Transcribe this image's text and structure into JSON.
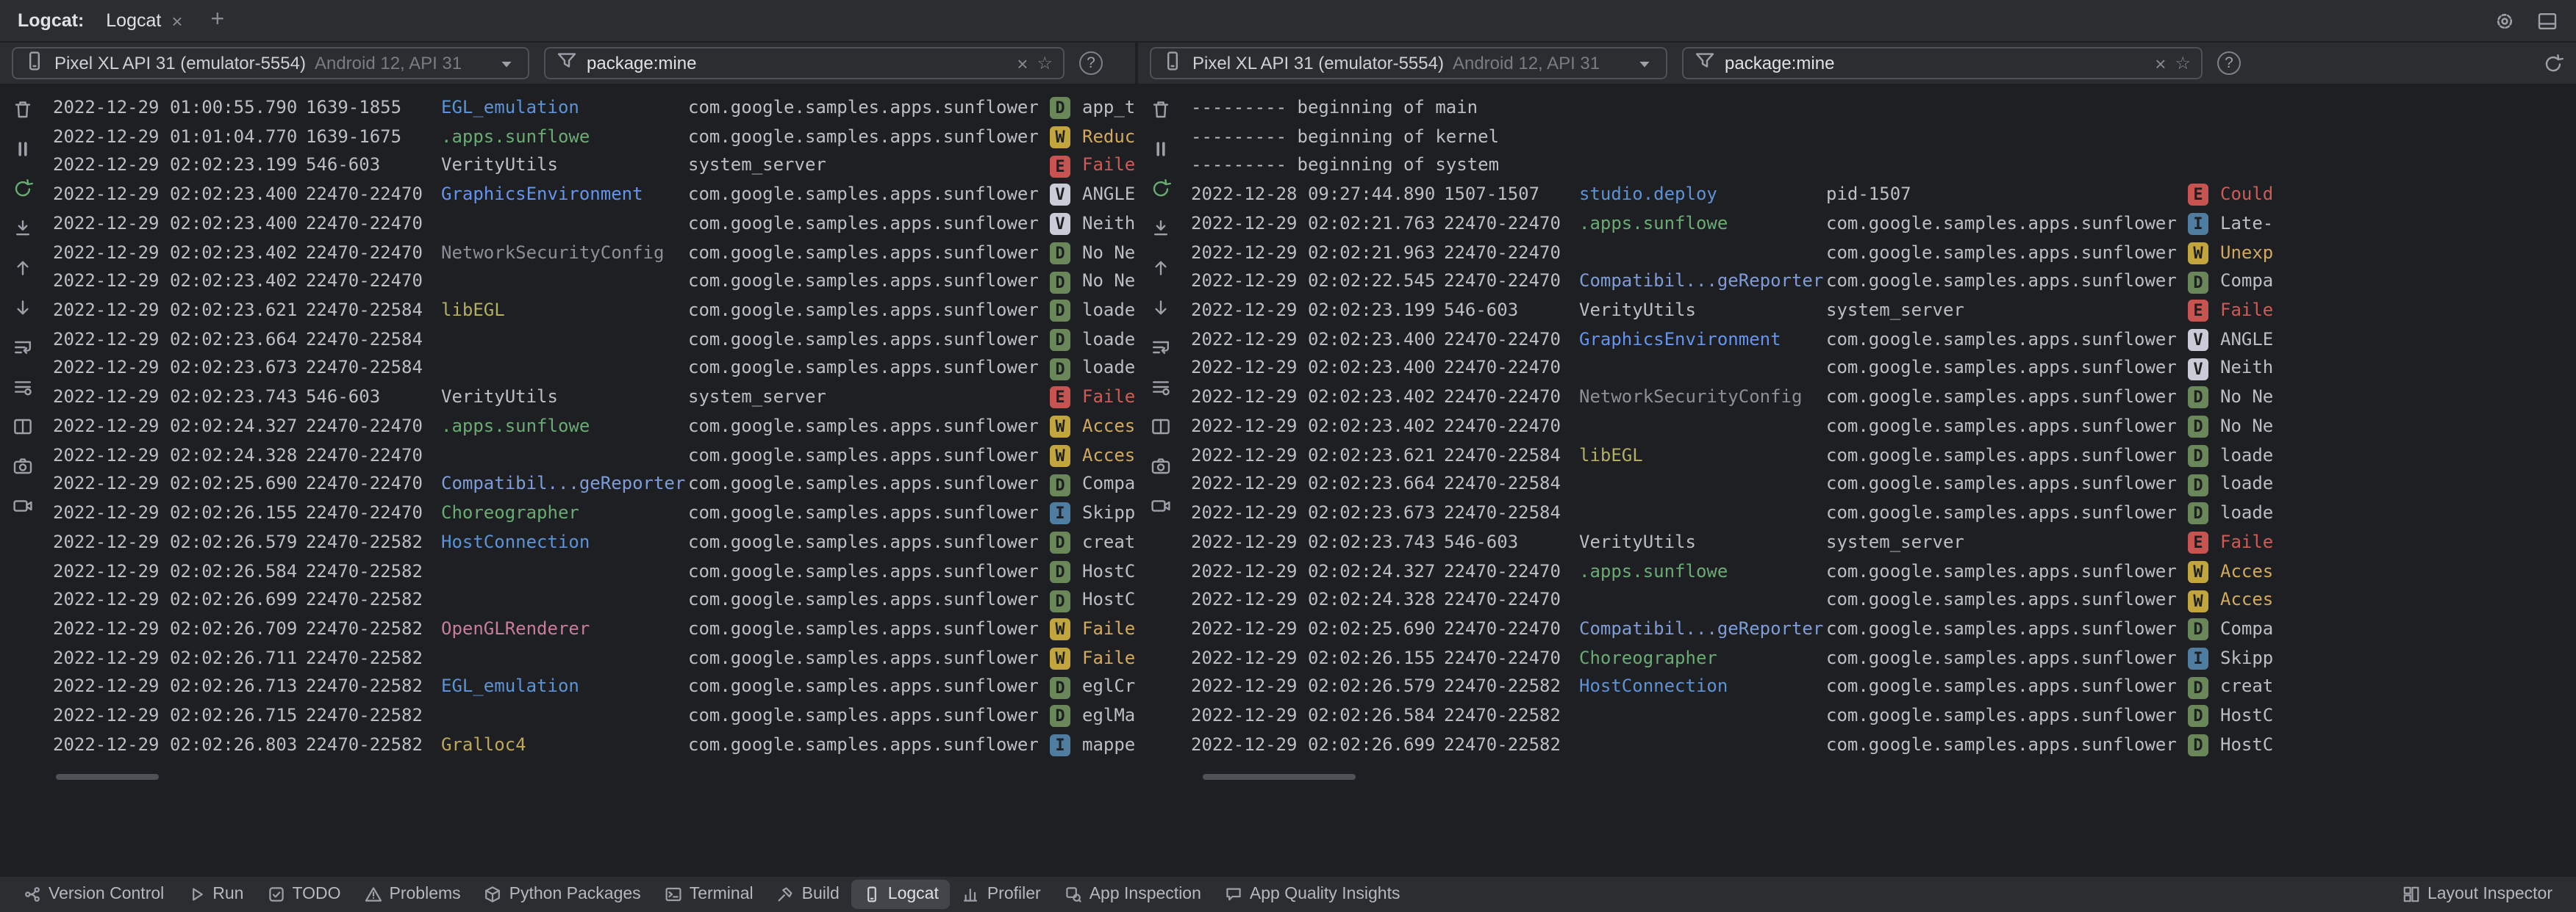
{
  "tab_bar": {
    "title": "Logcat:",
    "tabs": [
      {
        "label": "Logcat",
        "close": "×",
        "selected": true
      }
    ],
    "add_tab": "+"
  },
  "toolbar": {
    "clear_glyph": "×",
    "favorite_glyph": "☆",
    "help_glyph": "?"
  },
  "rail_icons": [
    "clear-logcat-icon",
    "pause-logcat-icon",
    "restart-logcat-icon",
    "scroll-to-end-icon",
    "previous-occurrence-icon",
    "next-occurrence-icon",
    "soft-wrap-icon",
    "configure-logcat-icon",
    "split-panels-icon",
    "screenshot-icon",
    "screen-record-icon"
  ],
  "log_colors": {
    "levels": {
      "V": {
        "bg": "#c9ccd6",
        "fg": "#1e1f22"
      },
      "D": {
        "bg": "#6a8759",
        "fg": "#1e1f22"
      },
      "I": {
        "bg": "#4f7da0",
        "fg": "#1e1f22"
      },
      "W": {
        "bg": "#c2a53c",
        "fg": "#1e1f22"
      },
      "E": {
        "bg": "#c75450",
        "fg": "#1e1f22"
      }
    },
    "messages": {
      "V": "#bcbec4",
      "D": "#bcbec4",
      "I": "#bcbec4",
      "W": "#d2a95d",
      "E": "#cf5b56"
    },
    "tags": {
      "default": "#bcbec4",
      "blue": "#5c93d6",
      "blue2": "#6494ed",
      "blue3": "#7e9cd8",
      "green": "#6aab73",
      "gray": "#8a8f98",
      "olive": "#b3ae60",
      "pink": "#c77d9b",
      "yellow": "#bfa65a"
    }
  },
  "panes": [
    {
      "device_label": "Pixel XL API 31 (emulator-5554)",
      "device_spec": "Android 12, API 31",
      "filter_value": "package:mine",
      "rows": [
        {
          "time": "2022-12-29 01:00:55.790",
          "pids": "1639-1855",
          "tag": "EGL_emulation",
          "tag_color": "blue",
          "package": "com.google.samples.apps.sunflower",
          "level": "D",
          "message": "app_t"
        },
        {
          "time": "2022-12-29 01:01:04.770",
          "pids": "1639-1675",
          "tag": ".apps.sunflowe",
          "tag_color": "green",
          "package": "com.google.samples.apps.sunflower",
          "level": "W",
          "message": "Reduc"
        },
        {
          "time": "2022-12-29 02:02:23.199",
          "pids": "546-603",
          "tag": "VerityUtils",
          "tag_color": "default",
          "package": "system_server",
          "level": "E",
          "message": "Faile"
        },
        {
          "time": "2022-12-29 02:02:23.400",
          "pids": "22470-22470",
          "tag": "GraphicsEnvironment",
          "tag_color": "blue2",
          "package": "com.google.samples.apps.sunflower",
          "level": "V",
          "message": "ANGLE"
        },
        {
          "time": "2022-12-29 02:02:23.400",
          "pids": "22470-22470",
          "tag": "",
          "tag_color": "default",
          "package": "com.google.samples.apps.sunflower",
          "level": "V",
          "message": "Neith"
        },
        {
          "time": "2022-12-29 02:02:23.402",
          "pids": "22470-22470",
          "tag": "NetworkSecurityConfig",
          "tag_color": "gray",
          "package": "com.google.samples.apps.sunflower",
          "level": "D",
          "message": "No Ne"
        },
        {
          "time": "2022-12-29 02:02:23.402",
          "pids": "22470-22470",
          "tag": "",
          "tag_color": "default",
          "package": "com.google.samples.apps.sunflower",
          "level": "D",
          "message": "No Ne"
        },
        {
          "time": "2022-12-29 02:02:23.621",
          "pids": "22470-22584",
          "tag": "libEGL",
          "tag_color": "olive",
          "package": "com.google.samples.apps.sunflower",
          "level": "D",
          "message": "loade"
        },
        {
          "time": "2022-12-29 02:02:23.664",
          "pids": "22470-22584",
          "tag": "",
          "tag_color": "default",
          "package": "com.google.samples.apps.sunflower",
          "level": "D",
          "message": "loade"
        },
        {
          "time": "2022-12-29 02:02:23.673",
          "pids": "22470-22584",
          "tag": "",
          "tag_color": "default",
          "package": "com.google.samples.apps.sunflower",
          "level": "D",
          "message": "loade"
        },
        {
          "time": "2022-12-29 02:02:23.743",
          "pids": "546-603",
          "tag": "VerityUtils",
          "tag_color": "default",
          "package": "system_server",
          "level": "E",
          "message": "Faile"
        },
        {
          "time": "2022-12-29 02:02:24.327",
          "pids": "22470-22470",
          "tag": ".apps.sunflowe",
          "tag_color": "green",
          "package": "com.google.samples.apps.sunflower",
          "level": "W",
          "message": "Acces"
        },
        {
          "time": "2022-12-29 02:02:24.328",
          "pids": "22470-22470",
          "tag": "",
          "tag_color": "default",
          "package": "com.google.samples.apps.sunflower",
          "level": "W",
          "message": "Acces"
        },
        {
          "time": "2022-12-29 02:02:25.690",
          "pids": "22470-22470",
          "tag": "Compatibil...geReporter",
          "tag_color": "blue3",
          "package": "com.google.samples.apps.sunflower",
          "level": "D",
          "message": "Compa"
        },
        {
          "time": "2022-12-29 02:02:26.155",
          "pids": "22470-22470",
          "tag": "Choreographer",
          "tag_color": "green",
          "package": "com.google.samples.apps.sunflower",
          "level": "I",
          "message": "Skipp"
        },
        {
          "time": "2022-12-29 02:02:26.579",
          "pids": "22470-22582",
          "tag": "HostConnection",
          "tag_color": "blue",
          "package": "com.google.samples.apps.sunflower",
          "level": "D",
          "message": "creat"
        },
        {
          "time": "2022-12-29 02:02:26.584",
          "pids": "22470-22582",
          "tag": "",
          "tag_color": "default",
          "package": "com.google.samples.apps.sunflower",
          "level": "D",
          "message": "HostC"
        },
        {
          "time": "2022-12-29 02:02:26.699",
          "pids": "22470-22582",
          "tag": "",
          "tag_color": "default",
          "package": "com.google.samples.apps.sunflower",
          "level": "D",
          "message": "HostC"
        },
        {
          "time": "2022-12-29 02:02:26.709",
          "pids": "22470-22582",
          "tag": "OpenGLRenderer",
          "tag_color": "pink",
          "package": "com.google.samples.apps.sunflower",
          "level": "W",
          "message": "Faile"
        },
        {
          "time": "2022-12-29 02:02:26.711",
          "pids": "22470-22582",
          "tag": "",
          "tag_color": "default",
          "package": "com.google.samples.apps.sunflower",
          "level": "W",
          "message": "Faile"
        },
        {
          "time": "2022-12-29 02:02:26.713",
          "pids": "22470-22582",
          "tag": "EGL_emulation",
          "tag_color": "blue",
          "package": "com.google.samples.apps.sunflower",
          "level": "D",
          "message": "eglCr"
        },
        {
          "time": "2022-12-29 02:02:26.715",
          "pids": "22470-22582",
          "tag": "",
          "tag_color": "default",
          "package": "com.google.samples.apps.sunflower",
          "level": "D",
          "message": "eglMa"
        },
        {
          "time": "2022-12-29 02:02:26.803",
          "pids": "22470-22582",
          "tag": "Gralloc4",
          "tag_color": "yellow",
          "package": "com.google.samples.apps.sunflower",
          "level": "I",
          "message": "mappe"
        }
      ]
    },
    {
      "device_label": "Pixel XL API 31 (emulator-5554)",
      "device_spec": "Android 12, API 31",
      "filter_value": "package:mine",
      "rows": [
        {
          "banner": "--------- beginning of main"
        },
        {
          "banner": "--------- beginning of kernel"
        },
        {
          "banner": "--------- beginning of system"
        },
        {
          "time": "2022-12-28 09:27:44.890",
          "pids": "1507-1507",
          "tag": "studio.deploy",
          "tag_color": "blue",
          "package": "pid-1507",
          "level": "E",
          "message": "Could"
        },
        {
          "time": "2022-12-29 02:02:21.763",
          "pids": "22470-22470",
          "tag": ".apps.sunflowe",
          "tag_color": "green",
          "package": "com.google.samples.apps.sunflower",
          "level": "I",
          "message": "Late-"
        },
        {
          "time": "2022-12-29 02:02:21.963",
          "pids": "22470-22470",
          "tag": "",
          "tag_color": "default",
          "package": "com.google.samples.apps.sunflower",
          "level": "W",
          "message": "Unexp"
        },
        {
          "time": "2022-12-29 02:02:22.545",
          "pids": "22470-22470",
          "tag": "Compatibil...geReporter",
          "tag_color": "blue3",
          "package": "com.google.samples.apps.sunflower",
          "level": "D",
          "message": "Compa"
        },
        {
          "time": "2022-12-29 02:02:23.199",
          "pids": "546-603",
          "tag": "VerityUtils",
          "tag_color": "default",
          "package": "system_server",
          "level": "E",
          "message": "Faile"
        },
        {
          "time": "2022-12-29 02:02:23.400",
          "pids": "22470-22470",
          "tag": "GraphicsEnvironment",
          "tag_color": "blue2",
          "package": "com.google.samples.apps.sunflower",
          "level": "V",
          "message": "ANGLE"
        },
        {
          "time": "2022-12-29 02:02:23.400",
          "pids": "22470-22470",
          "tag": "",
          "tag_color": "default",
          "package": "com.google.samples.apps.sunflower",
          "level": "V",
          "message": "Neith"
        },
        {
          "time": "2022-12-29 02:02:23.402",
          "pids": "22470-22470",
          "tag": "NetworkSecurityConfig",
          "tag_color": "gray",
          "package": "com.google.samples.apps.sunflower",
          "level": "D",
          "message": "No Ne"
        },
        {
          "time": "2022-12-29 02:02:23.402",
          "pids": "22470-22470",
          "tag": "",
          "tag_color": "default",
          "package": "com.google.samples.apps.sunflower",
          "level": "D",
          "message": "No Ne"
        },
        {
          "time": "2022-12-29 02:02:23.621",
          "pids": "22470-22584",
          "tag": "libEGL",
          "tag_color": "olive",
          "package": "com.google.samples.apps.sunflower",
          "level": "D",
          "message": "loade"
        },
        {
          "time": "2022-12-29 02:02:23.664",
          "pids": "22470-22584",
          "tag": "",
          "tag_color": "default",
          "package": "com.google.samples.apps.sunflower",
          "level": "D",
          "message": "loade"
        },
        {
          "time": "2022-12-29 02:02:23.673",
          "pids": "22470-22584",
          "tag": "",
          "tag_color": "default",
          "package": "com.google.samples.apps.sunflower",
          "level": "D",
          "message": "loade"
        },
        {
          "time": "2022-12-29 02:02:23.743",
          "pids": "546-603",
          "tag": "VerityUtils",
          "tag_color": "default",
          "package": "system_server",
          "level": "E",
          "message": "Faile"
        },
        {
          "time": "2022-12-29 02:02:24.327",
          "pids": "22470-22470",
          "tag": ".apps.sunflowe",
          "tag_color": "green",
          "package": "com.google.samples.apps.sunflower",
          "level": "W",
          "message": "Acces"
        },
        {
          "time": "2022-12-29 02:02:24.328",
          "pids": "22470-22470",
          "tag": "",
          "tag_color": "default",
          "package": "com.google.samples.apps.sunflower",
          "level": "W",
          "message": "Acces"
        },
        {
          "time": "2022-12-29 02:02:25.690",
          "pids": "22470-22470",
          "tag": "Compatibil...geReporter",
          "tag_color": "blue3",
          "package": "com.google.samples.apps.sunflower",
          "level": "D",
          "message": "Compa"
        },
        {
          "time": "2022-12-29 02:02:26.155",
          "pids": "22470-22470",
          "tag": "Choreographer",
          "tag_color": "green",
          "package": "com.google.samples.apps.sunflower",
          "level": "I",
          "message": "Skipp"
        },
        {
          "time": "2022-12-29 02:02:26.579",
          "pids": "22470-22582",
          "tag": "HostConnection",
          "tag_color": "blue",
          "package": "com.google.samples.apps.sunflower",
          "level": "D",
          "message": "creat"
        },
        {
          "time": "2022-12-29 02:02:26.584",
          "pids": "22470-22582",
          "tag": "",
          "tag_color": "default",
          "package": "com.google.samples.apps.sunflower",
          "level": "D",
          "message": "HostC"
        },
        {
          "time": "2022-12-29 02:02:26.699",
          "pids": "22470-22582",
          "tag": "",
          "tag_color": "default",
          "package": "com.google.samples.apps.sunflower",
          "level": "D",
          "message": "HostC"
        }
      ]
    }
  ],
  "status_bar": {
    "items": [
      {
        "icon": "version-control-icon",
        "label": "Version Control",
        "active": false
      },
      {
        "icon": "run-icon",
        "label": "Run",
        "active": false
      },
      {
        "icon": "todo-icon",
        "label": "TODO",
        "active": false
      },
      {
        "icon": "problems-icon",
        "label": "Problems",
        "active": false
      },
      {
        "icon": "python-packages-icon",
        "label": "Python Packages",
        "active": false
      },
      {
        "icon": "terminal-icon",
        "label": "Terminal",
        "active": false
      },
      {
        "icon": "build-icon",
        "label": "Build",
        "active": false
      },
      {
        "icon": "logcat-icon",
        "label": "Logcat",
        "active": true
      },
      {
        "icon": "profiler-icon",
        "label": "Profiler",
        "active": false
      },
      {
        "icon": "app-inspection-icon",
        "label": "App Inspection",
        "active": false
      },
      {
        "icon": "app-quality-insights-icon",
        "label": "App Quality Insights",
        "active": false
      }
    ],
    "right_items": [
      {
        "icon": "layout-inspector-icon",
        "label": "Layout Inspector",
        "active": false
      }
    ]
  }
}
